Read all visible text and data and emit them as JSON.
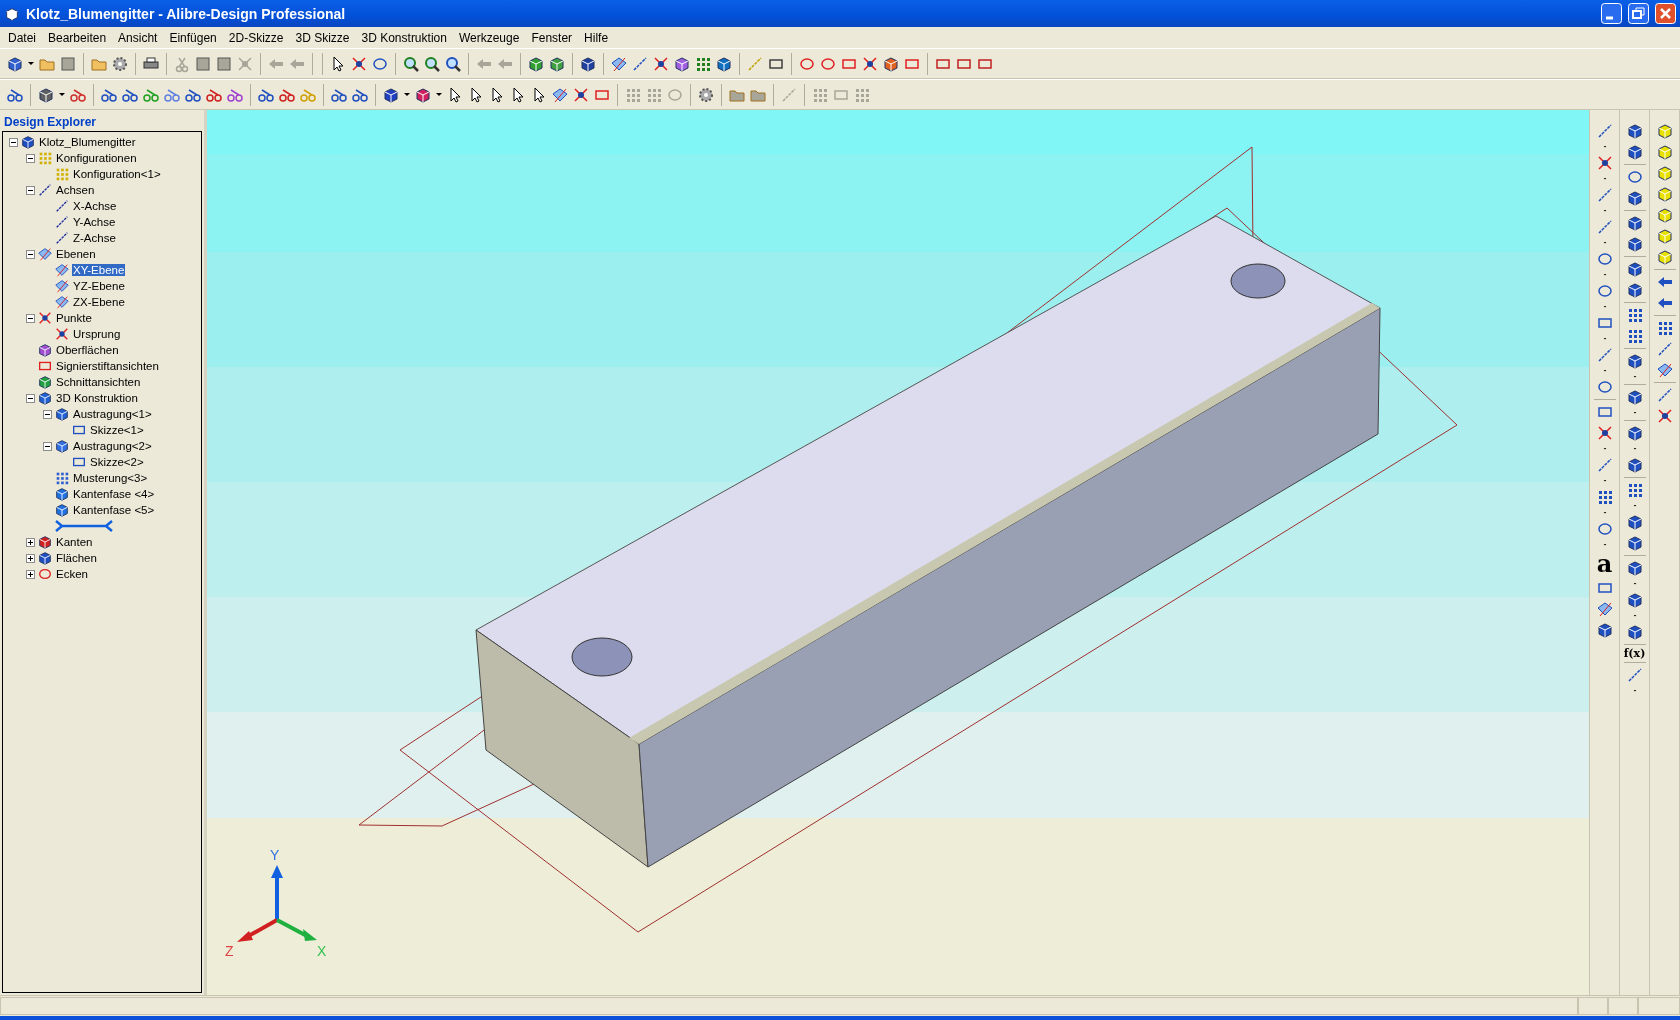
{
  "window": {
    "title": "Klotz_Blumengitter - Alibre-Design Professional"
  },
  "menu": [
    "Datei",
    "Bearbeiten",
    "Ansicht",
    "Einfügen",
    "2D-Skizze",
    "3D Skizze",
    "3D Konstruktion",
    "Werkzeuge",
    "Fenster",
    "Hilfe"
  ],
  "explorer": {
    "title": "Design Explorer",
    "tree": [
      {
        "label": "Klotz_Blumengitter",
        "expanded": true,
        "selected": false,
        "children": [
          {
            "label": "Konfigurationen",
            "expanded": true,
            "selected": false,
            "children": [
              {
                "label": "Konfiguration<1>",
                "selected": false
              }
            ]
          },
          {
            "label": "Achsen",
            "expanded": true,
            "selected": false,
            "children": [
              {
                "label": "X-Achse",
                "selected": false
              },
              {
                "label": "Y-Achse",
                "selected": false
              },
              {
                "label": "Z-Achse",
                "selected": false
              }
            ]
          },
          {
            "label": "Ebenen",
            "expanded": true,
            "selected": false,
            "children": [
              {
                "label": "XY-Ebene",
                "selected": true
              },
              {
                "label": "YZ-Ebene",
                "selected": false
              },
              {
                "label": "ZX-Ebene",
                "selected": false
              }
            ]
          },
          {
            "label": "Punkte",
            "expanded": true,
            "selected": false,
            "children": [
              {
                "label": "Ursprung",
                "selected": false
              }
            ]
          },
          {
            "label": "Oberflächen",
            "selected": false
          },
          {
            "label": "Signierstiftansichten",
            "selected": false
          },
          {
            "label": "Schnittansichten",
            "selected": false
          },
          {
            "label": "3D Konstruktion",
            "expanded": true,
            "selected": false,
            "children": [
              {
                "label": "Austragung<1>",
                "expanded": true,
                "selected": false,
                "children": [
                  {
                    "label": "Skizze<1>",
                    "selected": false
                  }
                ]
              },
              {
                "label": "Austragung<2>",
                "expanded": true,
                "selected": false,
                "children": [
                  {
                    "label": "Skizze<2>",
                    "selected": false
                  }
                ]
              },
              {
                "label": "Musterung<3>",
                "selected": false
              },
              {
                "label": "Kantenfase <4>",
                "selected": false
              },
              {
                "label": "Kantenfase <5>",
                "selected": false
              },
              {
                "kind": "rollback"
              }
            ]
          },
          {
            "label": "Kanten",
            "expanded": false,
            "selected": false
          },
          {
            "label": "Flächen",
            "expanded": false,
            "selected": false
          },
          {
            "label": "Ecken",
            "expanded": false,
            "selected": false
          }
        ]
      }
    ]
  },
  "viewport": {
    "axes": [
      {
        "label": "Y"
      },
      {
        "label": "Z"
      },
      {
        "label": "X"
      }
    ]
  },
  "right_toolbars": {
    "text_tool": "a",
    "function_tool": "f(x)"
  }
}
